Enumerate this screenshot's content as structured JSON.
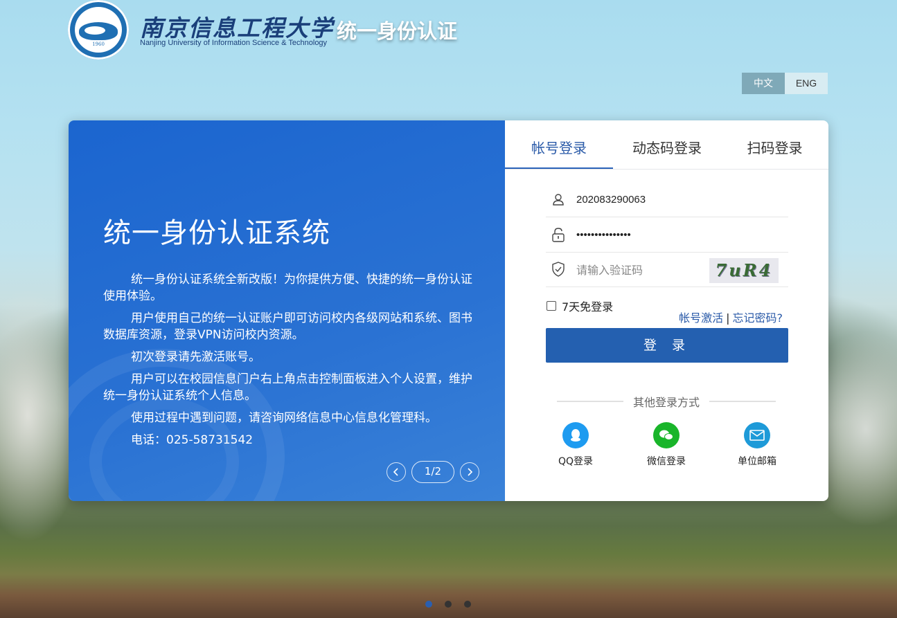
{
  "header": {
    "university_cn": "南京信息工程大学",
    "university_en": "Nanjing University of Information Science & Technology",
    "logo_year": "1960",
    "system_title": "统一身份认证"
  },
  "language": {
    "cn": "中文",
    "en": "ENG",
    "selected": "中文"
  },
  "intro": {
    "title": "统一身份认证系统",
    "paragraphs": [
      "统一身份认证系统全新改版！为你提供方便、快捷的统一身份认证使用体验。",
      "用户使用自己的统一认证账户即可访问校内各级网站和系统、图书数据库资源，登录VPN访问校内资源。",
      "初次登录请先激活账号。",
      "用户可以在校园信息门户右上角点击控制面板进入个人设置，维护统一身份认证系统个人信息。",
      "使用过程中遇到问题，请咨询网络信息中心信息化管理科。",
      "电话：025-58731542"
    ],
    "page_indicator": "1/2"
  },
  "login": {
    "tabs": [
      {
        "label": "帐号登录",
        "active": true
      },
      {
        "label": "动态码登录",
        "active": false
      },
      {
        "label": "扫码登录",
        "active": false
      }
    ],
    "username_value": "202083290063",
    "password_value": "•••••••••••••••",
    "captcha_placeholder": "请输入验证码",
    "captcha_text": "7uR4",
    "remember_label": "7天免登录",
    "activate_link": "帐号激活",
    "forgot_link": "忘记密码?",
    "submit_label": "登 录",
    "other_title": "其他登录方式",
    "other_methods": [
      {
        "label": "QQ登录",
        "icon": "qq-icon",
        "color": "#1e9bf0"
      },
      {
        "label": "微信登录",
        "icon": "wechat-icon",
        "color": "#19b52a"
      },
      {
        "label": "单位邮箱",
        "icon": "mail-icon",
        "color": "#1e9ad8"
      }
    ]
  },
  "carousel": {
    "total": 3,
    "active": 1
  },
  "colors": {
    "primary": "#2460b0",
    "panel_blue": "#1b65cf",
    "link": "#2a5aa8"
  }
}
